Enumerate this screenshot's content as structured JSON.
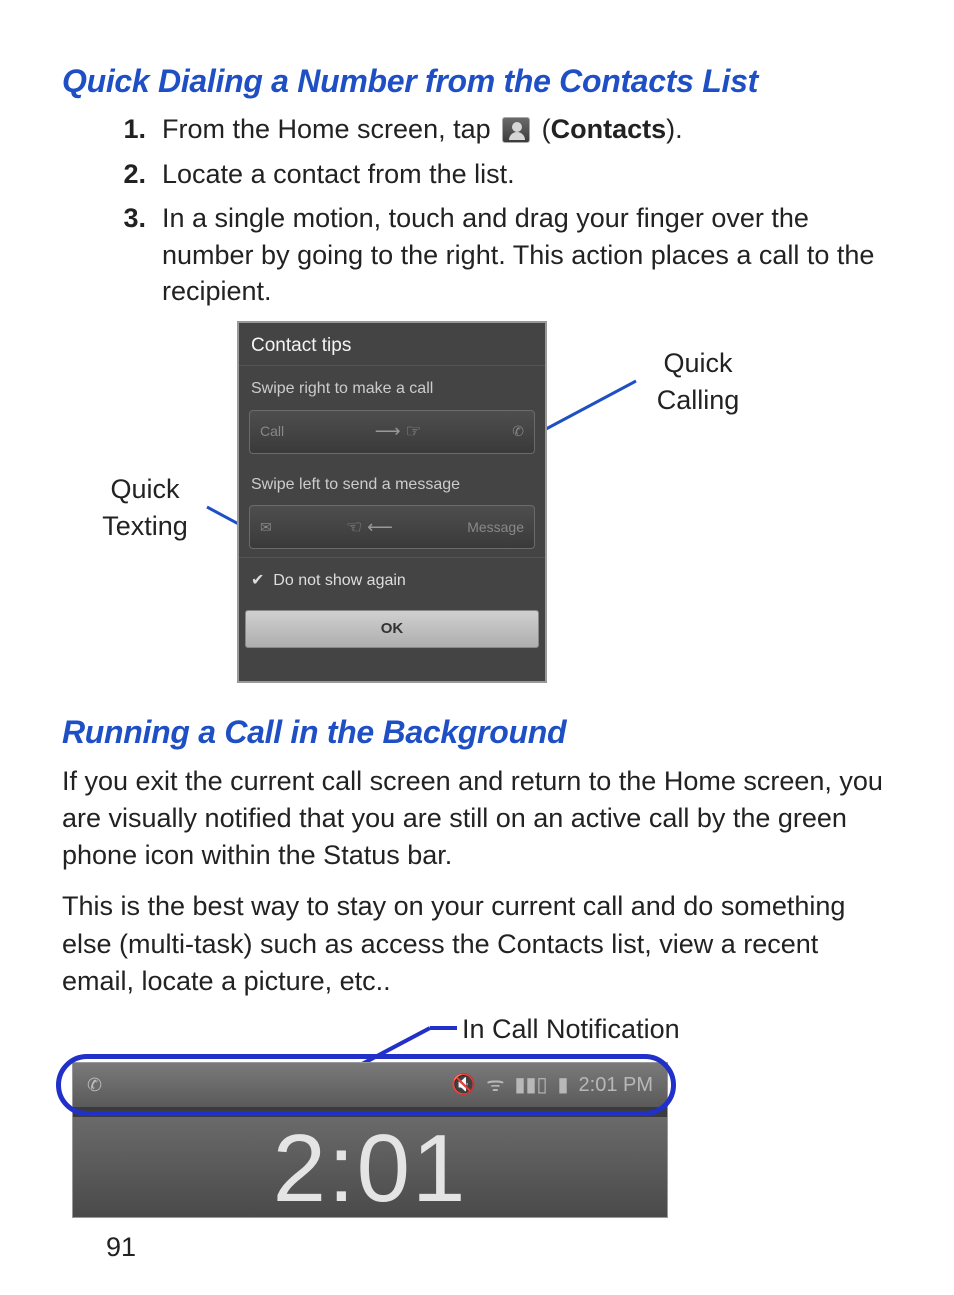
{
  "headings": {
    "quick_dialing": "Quick Dialing a Number from the Contacts List",
    "running_bg": "Running a Call in the Background"
  },
  "steps": {
    "s1_pre": "From the Home screen, tap ",
    "s1_post_open": " (",
    "s1_bold": "Contacts",
    "s1_post_close": ").",
    "s2": "Locate a contact from the list.",
    "s3": "In a single motion, touch and drag your finger over the number by going to the right. This action places a call to the recipient.",
    "n1": "1.",
    "n2": "2.",
    "n3": "3."
  },
  "fig1": {
    "label_quick_texting": "Quick Texting",
    "label_quick_calling": "Quick Calling",
    "header": "Contact tips",
    "swipe_right": "Swipe right to make a call",
    "call_label": "Call",
    "swipe_left": "Swipe left to send a message",
    "message_label": "Message",
    "do_not_show": "Do not show again",
    "ok": "OK"
  },
  "para1": "If you exit the current call screen and return to the Home screen, you are visually notified that you are still on an active call by the green phone icon within the Status bar.",
  "para2": "This is the best way to stay on your current call and do something else (multi-task) such as access the Contacts list, view a recent email, locate a picture, etc..",
  "fig2": {
    "label_incall": "In Call Notification",
    "time": "2:01 PM",
    "clock": "2:01"
  },
  "page_number": "91"
}
